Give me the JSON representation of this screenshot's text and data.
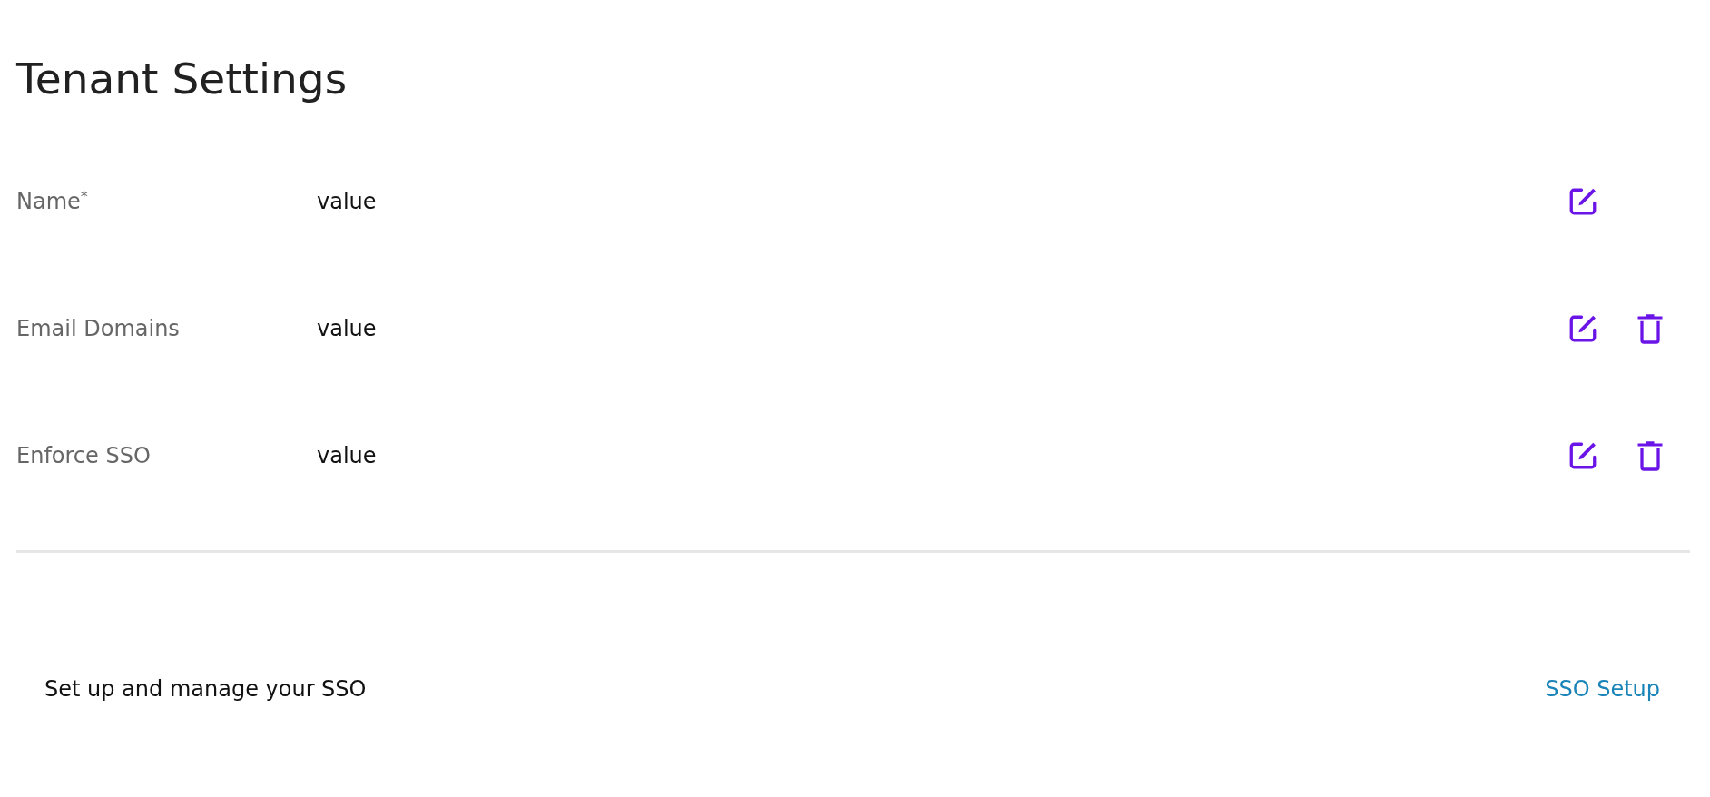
{
  "title": "Tenant Settings",
  "rows": [
    {
      "label": "Name$^{*}$",
      "value": "value",
      "deletable": false
    },
    {
      "label": "Email Domains",
      "value": "value",
      "deletable": true
    },
    {
      "label": "Enforce SSO",
      "value": "value",
      "deletable": true
    }
  ],
  "sso": {
    "text": "Set up and manage your SSO",
    "link": "SSO Setup"
  }
}
